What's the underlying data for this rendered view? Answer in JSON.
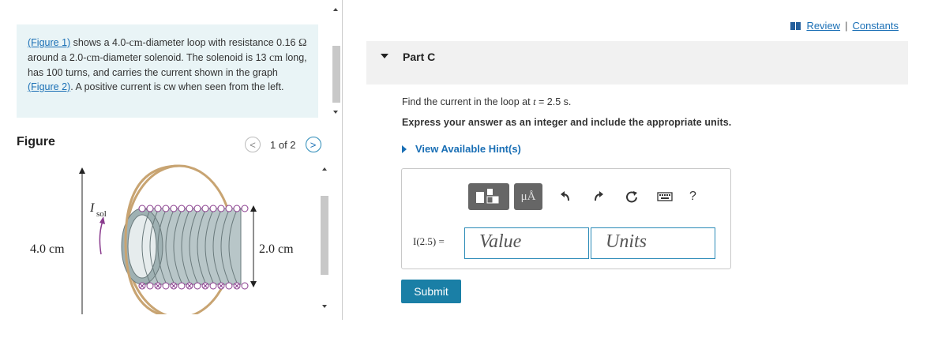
{
  "problem": {
    "figure1_link": "(Figure 1)",
    "part1": " shows a 4.0-",
    "cm1": "cm",
    "part2": "-diameter loop with resistance 0.16 ",
    "ohm": "Ω",
    "part3": " around a 2.0-",
    "cm2": "cm",
    "part4": "-diameter solenoid. The solenoid is 13 ",
    "cm3": "cm",
    "part5": " long, has 100 turns, and carries the current shown in the graph ",
    "figure2_link": "(Figure 2)",
    "part6": ". A positive current is cw when seen from the left."
  },
  "figure": {
    "title": "Figure",
    "pager": "1 of 2",
    "prev": "<",
    "next": ">",
    "label_loop": "4.0 cm",
    "label_sol": "2.0 cm",
    "label_i": "I",
    "label_i_sub": "sol"
  },
  "header": {
    "review": "Review",
    "constants": "Constants",
    "sep": "|"
  },
  "part": {
    "title": "Part C",
    "question": "Find the current in the loop at ",
    "question_var": "t",
    "question_rest": " = 2.5 s.",
    "instruction": "Express your answer as an integer and include the appropriate units.",
    "hint": "View Available Hint(s)"
  },
  "answer": {
    "tool_units": "μÅ",
    "help": "?",
    "label": "I(2.5) =",
    "value_placeholder": "Value",
    "units_placeholder": "Units",
    "submit": "Submit"
  },
  "colors": {
    "accent": "#1a7fa6",
    "link": "#1a6fb5",
    "problem_bg": "#e9f4f6",
    "loop": "#c8a472",
    "solenoid": "#a9b8ba"
  }
}
